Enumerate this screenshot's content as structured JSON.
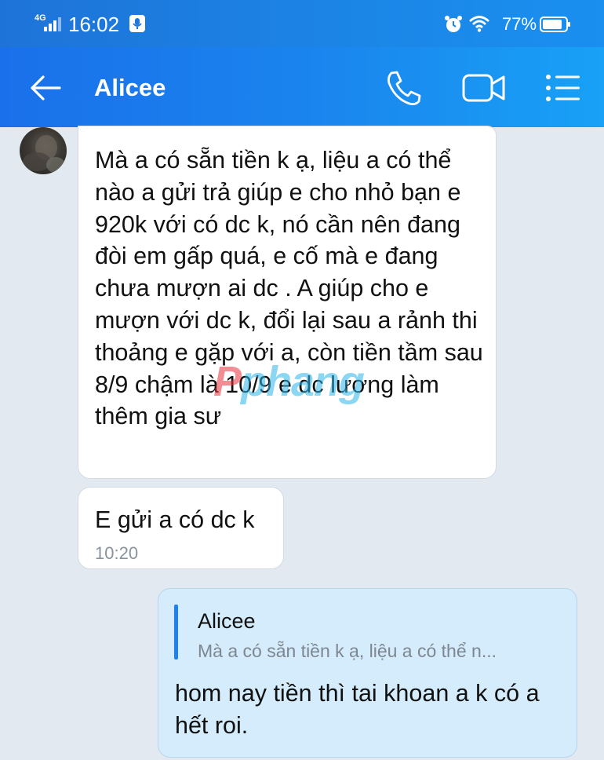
{
  "status_bar": {
    "network": "4G",
    "time": "16:02",
    "battery_percent": "77%",
    "icons": [
      "signal-icon",
      "mic-icon",
      "alarm-icon",
      "wifi-icon",
      "battery-icon"
    ]
  },
  "header": {
    "contact_name": "Alicee",
    "icons": [
      "back-arrow-icon",
      "phone-icon",
      "video-camera-icon",
      "menu-list-icon"
    ]
  },
  "messages": [
    {
      "sender": "incoming",
      "text": "Mà a có sẵn tiền k ạ, liệu a có thể nào a gửi trả giúp e cho nhỏ bạn e 920k với có dc k, nó cần nên đang đòi em gấp quá, e cố mà e đang chưa mượn ai dc . A giúp cho e mượn với dc k, đổi lại sau a rảnh thi thoảng e gặp với a, còn tiền tầm sau 8/9 chậm là 10/9 e dc lương làm thêm gia sư"
    },
    {
      "sender": "incoming",
      "text": "E gửi a có dc k",
      "time": "10:20"
    },
    {
      "sender": "outgoing",
      "quote": {
        "name": "Alicee",
        "text": "Mà a có sẵn tiền k ạ, liệu a có thể n..."
      },
      "text": "hom nay tiền thì tai khoan a k có a hết roi."
    }
  ],
  "watermark": {
    "first": "P",
    "rest": "phang"
  },
  "colors": {
    "header_start": "#1a70ea",
    "header_end": "#18a1f6",
    "chat_background": "#e2e9f1",
    "incoming_bubble": "#ffffff",
    "outgoing_bubble": "#d4ecfb",
    "quote_bar": "#1f82e8"
  }
}
